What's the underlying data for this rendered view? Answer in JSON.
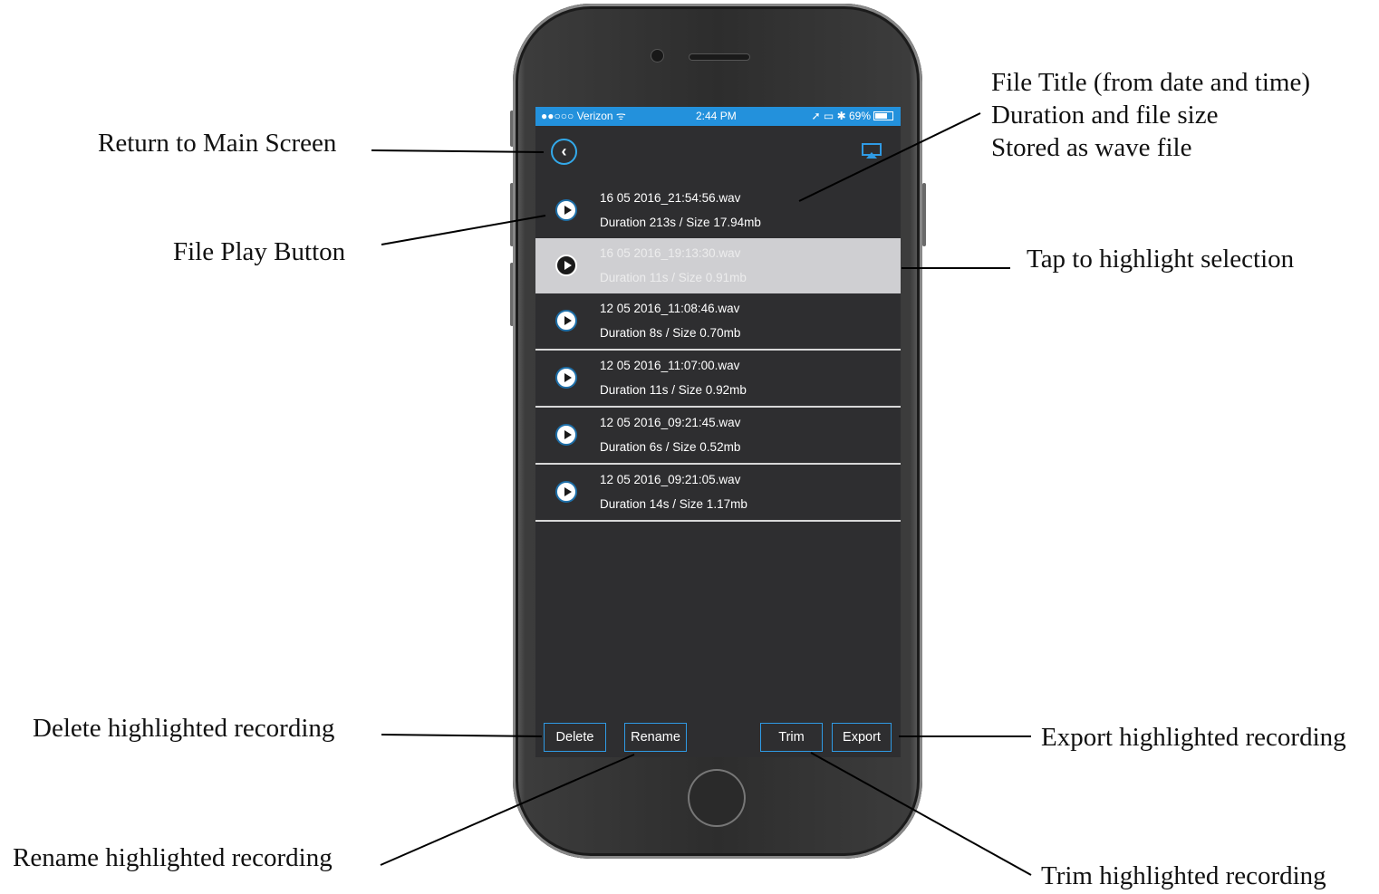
{
  "annotations": {
    "back": "Return to Main Screen",
    "play": "File Play Button",
    "title_1": "File Title (from date and time)",
    "title_2": "Duration and file size",
    "title_3": "Stored as wave file",
    "tap": "Tap to highlight selection",
    "delete": "Delete highlighted recording",
    "rename": "Rename highlighted recording",
    "export": "Export highlighted recording",
    "trim": "Trim highlighted recording"
  },
  "status_bar": {
    "carrier": "●●○○○ Verizon ᯤ",
    "time": "2:44 PM",
    "right": "➚ ▭ ✱ 69%"
  },
  "header": {
    "back_icon": "chevron-left-icon",
    "airplay_icon": "airplay-icon"
  },
  "recordings": [
    {
      "title": "16 05 2016_21:54:56.wav",
      "details": "Duration 213s / Size 17.94mb",
      "selected": false
    },
    {
      "title": "16 05 2016_19:13:30.wav",
      "details": "Duration 11s / Size 0.91mb",
      "selected": true
    },
    {
      "title": "12 05 2016_11:08:46.wav",
      "details": "Duration 8s / Size 0.70mb",
      "selected": false
    },
    {
      "title": "12 05 2016_11:07:00.wav",
      "details": "Duration 11s / Size 0.92mb",
      "selected": false
    },
    {
      "title": "12 05 2016_09:21:45.wav",
      "details": "Duration 6s / Size 0.52mb",
      "selected": false
    },
    {
      "title": "12 05 2016_09:21:05.wav",
      "details": "Duration 14s / Size 1.17mb",
      "selected": false
    }
  ],
  "toolbar": {
    "delete_label": "Delete",
    "rename_label": "Rename",
    "trim_label": "Trim",
    "export_label": "Export"
  },
  "colors": {
    "accent": "#2f9ae4",
    "status_bar": "#2391dc",
    "screen_bg": "#2e2e30",
    "selected_row": "#cfcfd2"
  }
}
